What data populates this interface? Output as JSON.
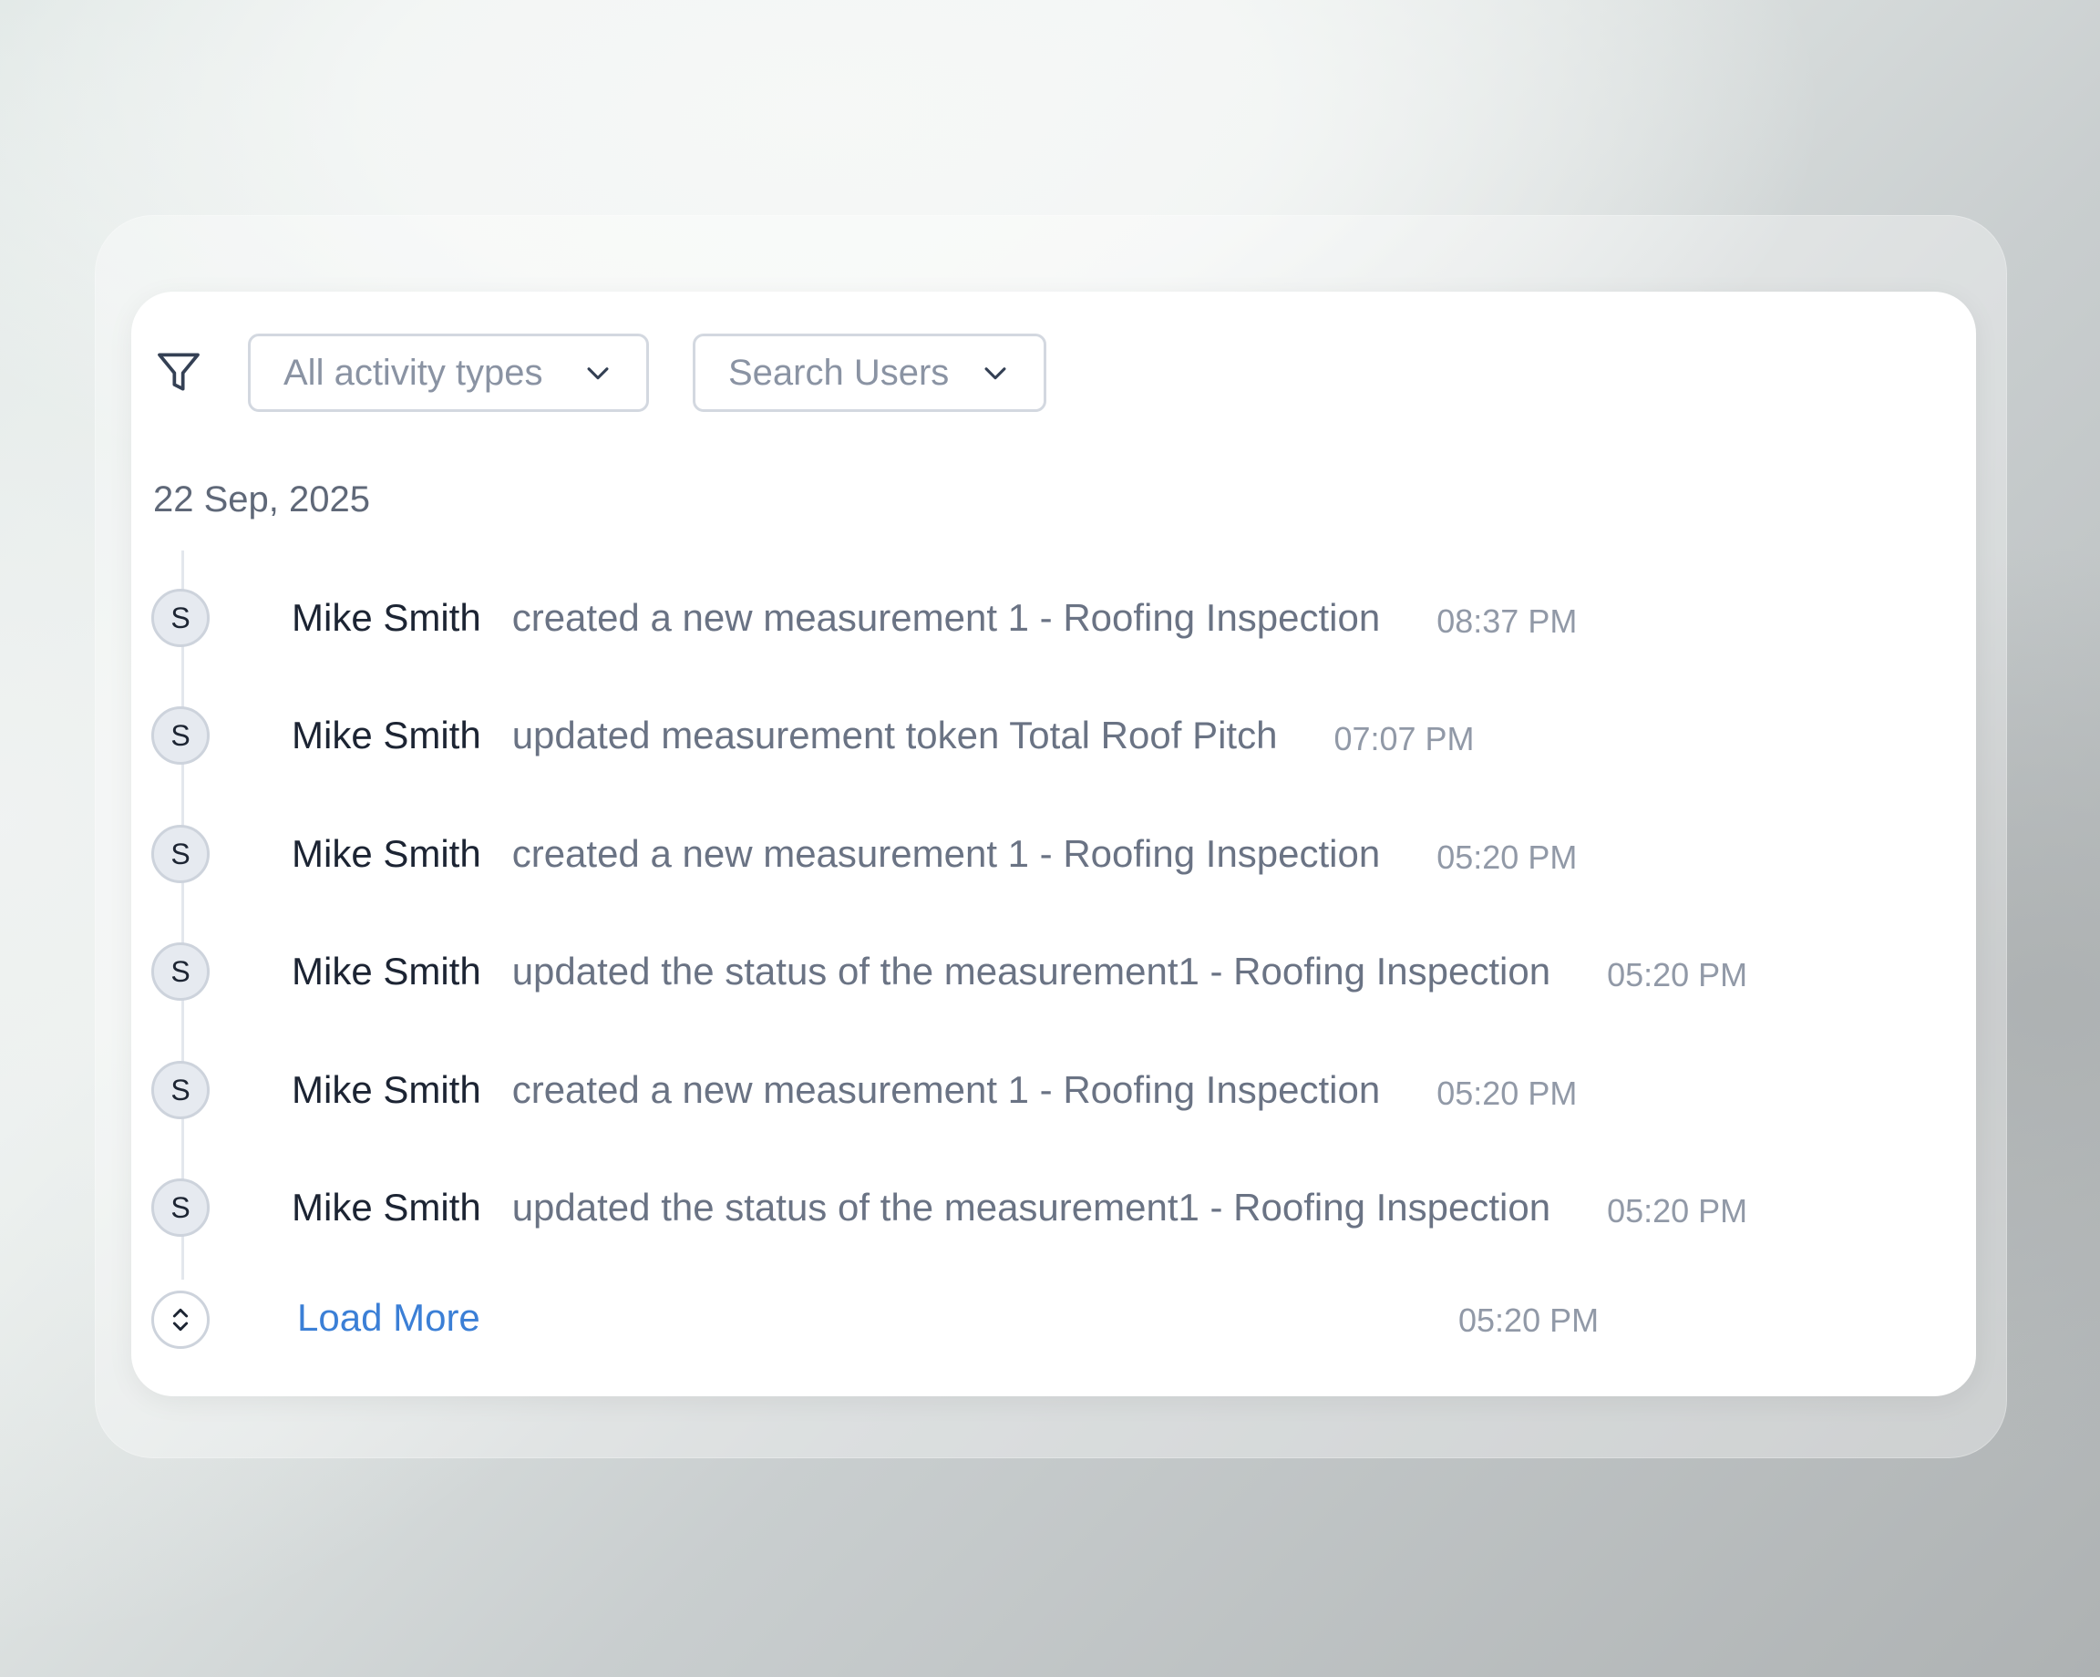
{
  "filters": {
    "activity_type": {
      "selected": "All activity types"
    },
    "users": {
      "placeholder": "Search Users"
    }
  },
  "date_group": "22 Sep, 2025",
  "activities": [
    {
      "initial": "S",
      "user": "Mike Smith",
      "action": "created a new measurement 1 - Roofing Inspection",
      "time": "08:37 PM"
    },
    {
      "initial": "S",
      "user": "Mike Smith",
      "action": "updated measurement token Total Roof Pitch",
      "time": "07:07 PM"
    },
    {
      "initial": "S",
      "user": "Mike Smith",
      "action": "created a new measurement 1 - Roofing Inspection",
      "time": "05:20 PM"
    },
    {
      "initial": "S",
      "user": "Mike Smith",
      "action": "updated the status of the measurement1 - Roofing Inspection",
      "time": "05:20 PM"
    },
    {
      "initial": "S",
      "user": "Mike Smith",
      "action": "created a new measurement 1 - Roofing Inspection",
      "time": "05:20 PM"
    },
    {
      "initial": "S",
      "user": "Mike Smith",
      "action": "updated the status of the measurement1 - Roofing Inspection",
      "time": "05:20 PM"
    }
  ],
  "load_more": {
    "label": "Load More",
    "time": "05:20 PM"
  },
  "icons": {
    "filter": "filter-icon",
    "dropdown": "chevron-down-icon",
    "load_more": "expand-vertical-icon"
  },
  "colors": {
    "link": "#3b7fd6",
    "user_name": "#1c2433",
    "action_text": "#6a7384",
    "timestamp": "#9199a7"
  }
}
